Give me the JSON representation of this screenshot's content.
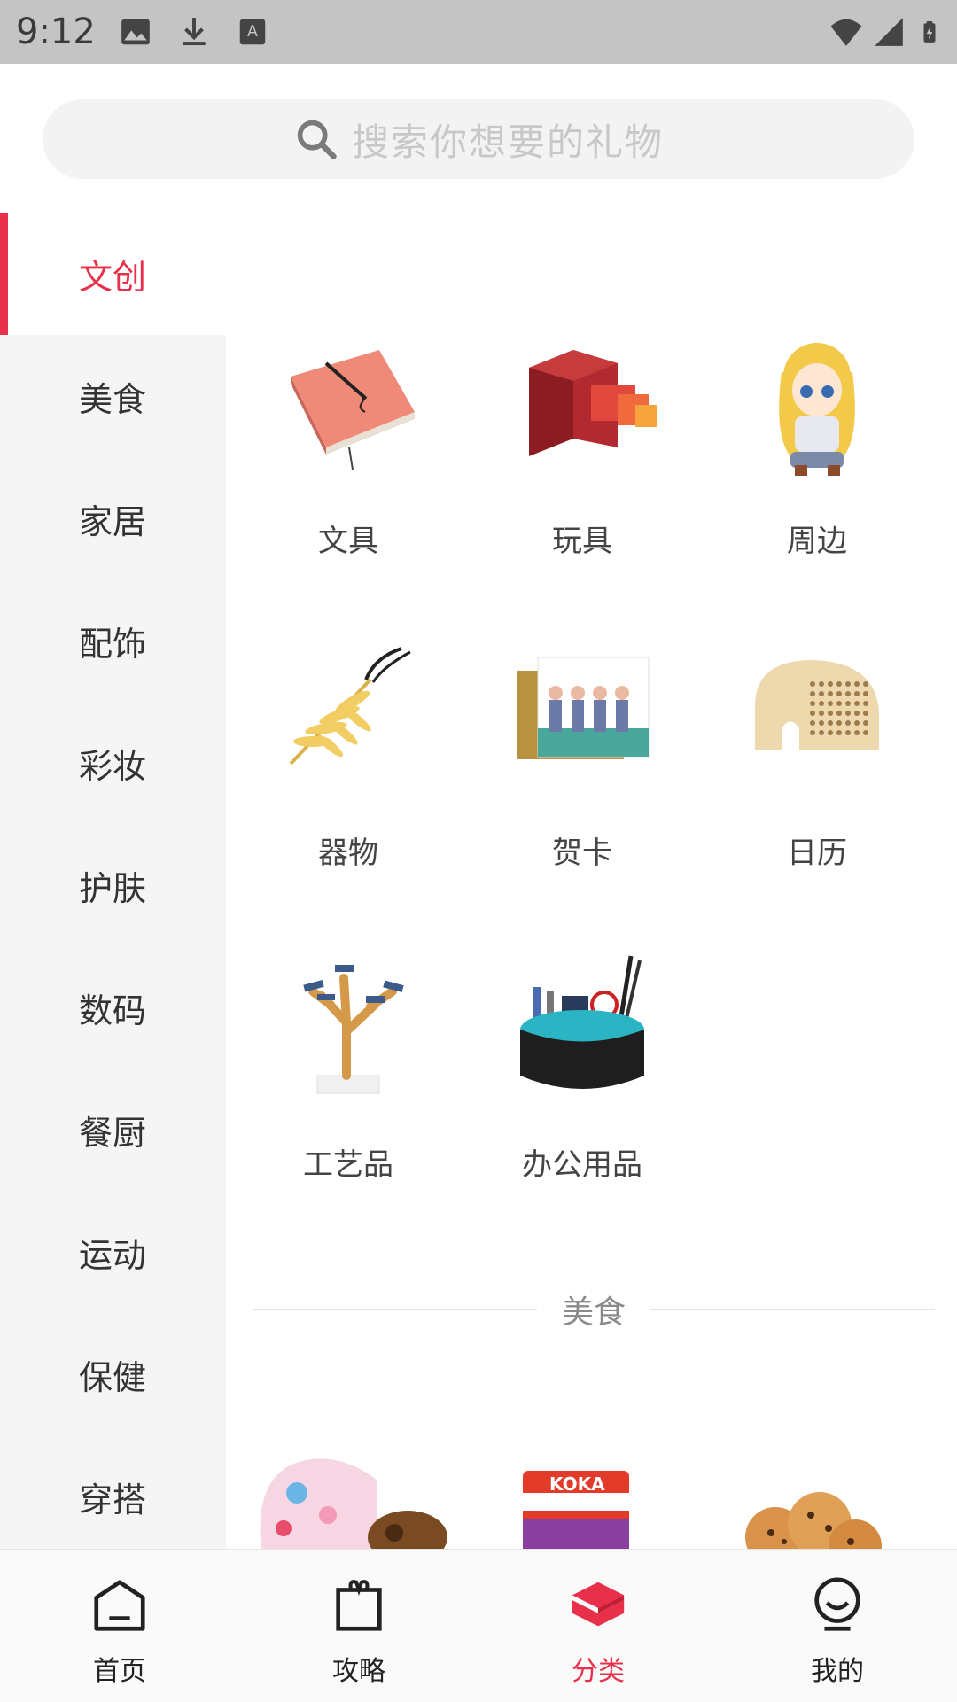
{
  "status_bar": {
    "time": "9:12"
  },
  "search": {
    "placeholder": "搜索你想要的礼物"
  },
  "sidebar": {
    "items": [
      {
        "label": "文创",
        "active": true
      },
      {
        "label": "美食"
      },
      {
        "label": "家居"
      },
      {
        "label": "配饰"
      },
      {
        "label": "彩妆"
      },
      {
        "label": "护肤"
      },
      {
        "label": "数码"
      },
      {
        "label": "餐厨"
      },
      {
        "label": "运动"
      },
      {
        "label": "保健"
      },
      {
        "label": "穿搭"
      }
    ]
  },
  "content": {
    "subcategories": [
      {
        "label": "文具",
        "icon": "notebook-image"
      },
      {
        "label": "玩具",
        "icon": "drawer-toy-image"
      },
      {
        "label": "周边",
        "icon": "anime-figure-image"
      },
      {
        "label": "器物",
        "icon": "leaf-bookmark-image"
      },
      {
        "label": "贺卡",
        "icon": "greeting-card-image"
      },
      {
        "label": "日历",
        "icon": "elephant-calendar-image"
      },
      {
        "label": "工艺品",
        "icon": "tree-sculpture-image"
      },
      {
        "label": "办公用品",
        "icon": "desk-organizer-image"
      }
    ],
    "next_section": {
      "label": "美食"
    },
    "food_preview": [
      "chocolate-box-image",
      "snack-bag-image",
      "cookies-image"
    ]
  },
  "bottom_nav": {
    "items": [
      {
        "label": "首页",
        "icon": "home-icon"
      },
      {
        "label": "攻略",
        "icon": "gift-icon"
      },
      {
        "label": "分类",
        "icon": "category-icon",
        "active": true
      },
      {
        "label": "我的",
        "icon": "profile-icon"
      }
    ]
  },
  "colors": {
    "accent": "#e8304a",
    "sidebar_bg": "#f5f5f5",
    "status_bg": "#c4c4c4"
  }
}
